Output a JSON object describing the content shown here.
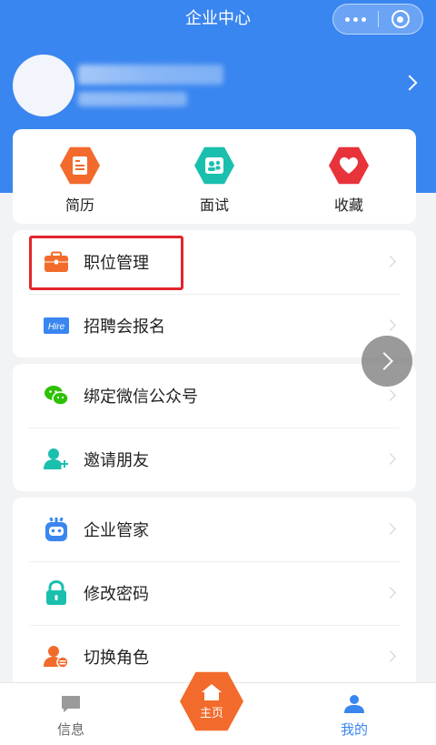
{
  "nav": {
    "title": "企业中心"
  },
  "quick": [
    {
      "label": "简历",
      "icon": "resume-icon",
      "color": "#f26b2c"
    },
    {
      "label": "面试",
      "icon": "interview-icon",
      "color": "#1bbfae"
    },
    {
      "label": "收藏",
      "icon": "heart-icon",
      "color": "#e8333b"
    }
  ],
  "menu": {
    "group1": [
      {
        "label": "职位管理",
        "icon": "briefcase-icon"
      },
      {
        "label": "招聘会报名",
        "icon": "hire-icon",
        "icon_text": "Hire"
      }
    ],
    "group2": [
      {
        "label": "绑定微信公众号",
        "icon": "wechat-icon"
      },
      {
        "label": "邀请朋友",
        "icon": "add-friend-icon"
      }
    ],
    "group3": [
      {
        "label": "企业管家",
        "icon": "robot-icon"
      },
      {
        "label": "修改密码",
        "icon": "lock-icon"
      },
      {
        "label": "切换角色",
        "icon": "switch-role-icon"
      }
    ]
  },
  "tabbar": {
    "messages": "信息",
    "home": "主页",
    "mine": "我的"
  },
  "colors": {
    "primary": "#3a86f0",
    "orange": "#f26b2c",
    "teal": "#1bbfae",
    "red": "#e8333b",
    "highlight": "#e0262c"
  }
}
